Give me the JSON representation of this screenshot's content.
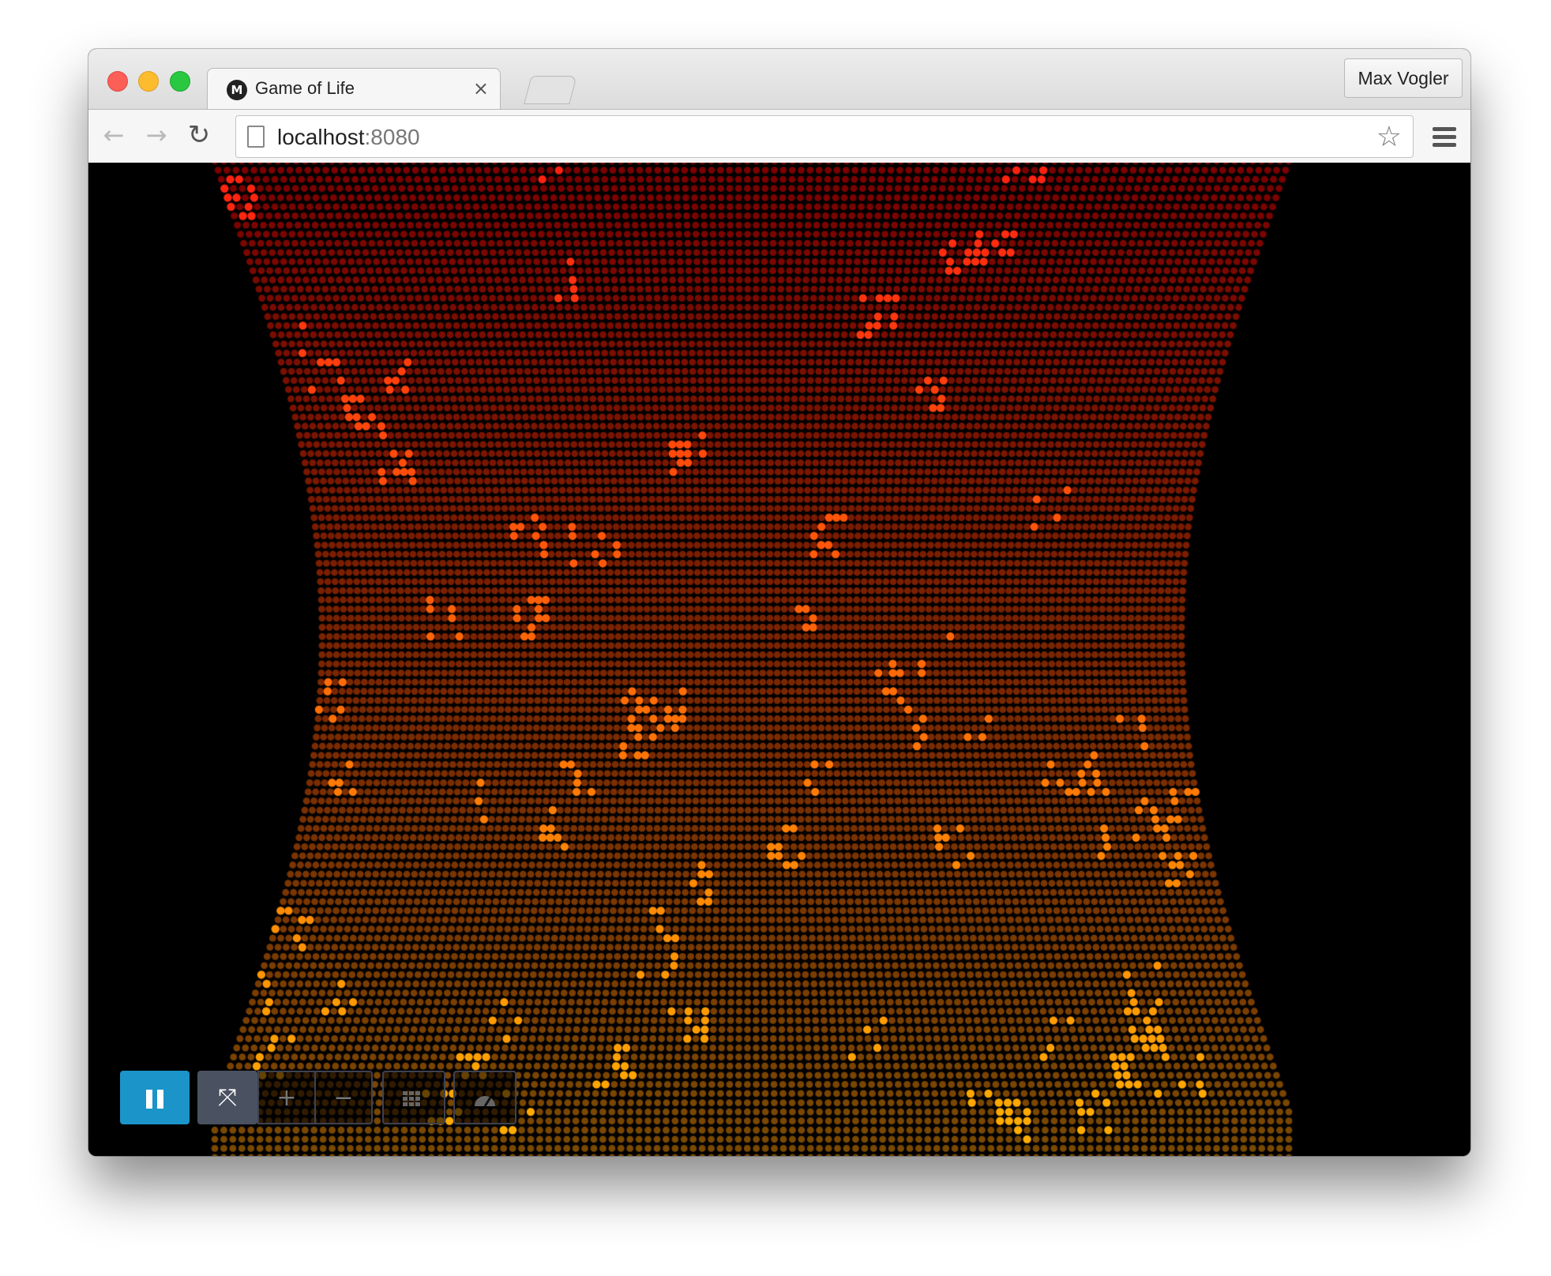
{
  "window": {
    "profile_name": "Max Vogler"
  },
  "tab": {
    "title": "Game of Life",
    "favicon_letter": "M",
    "close_glyph": "×"
  },
  "toolbar": {
    "back_icon": "←",
    "forward_icon": "→",
    "reload_icon": "↻",
    "url_host": "localhost",
    "url_port": ":8080",
    "star_icon": "☆"
  },
  "controls": {
    "pause_icon": "pause-icon",
    "fullscreen_icon": "⤧",
    "zoom_in_icon": "+",
    "zoom_out_icon": "−",
    "grid_icon": "grid-icon",
    "speed_icon": "speedometer-icon",
    "accent_color": "#1b94c9"
  },
  "game": {
    "colors": {
      "top_dead": "#7a0000",
      "bottom_dead": "#7a4a00",
      "top_alive": "#ff2010",
      "bottom_alive": "#ffb000"
    }
  }
}
